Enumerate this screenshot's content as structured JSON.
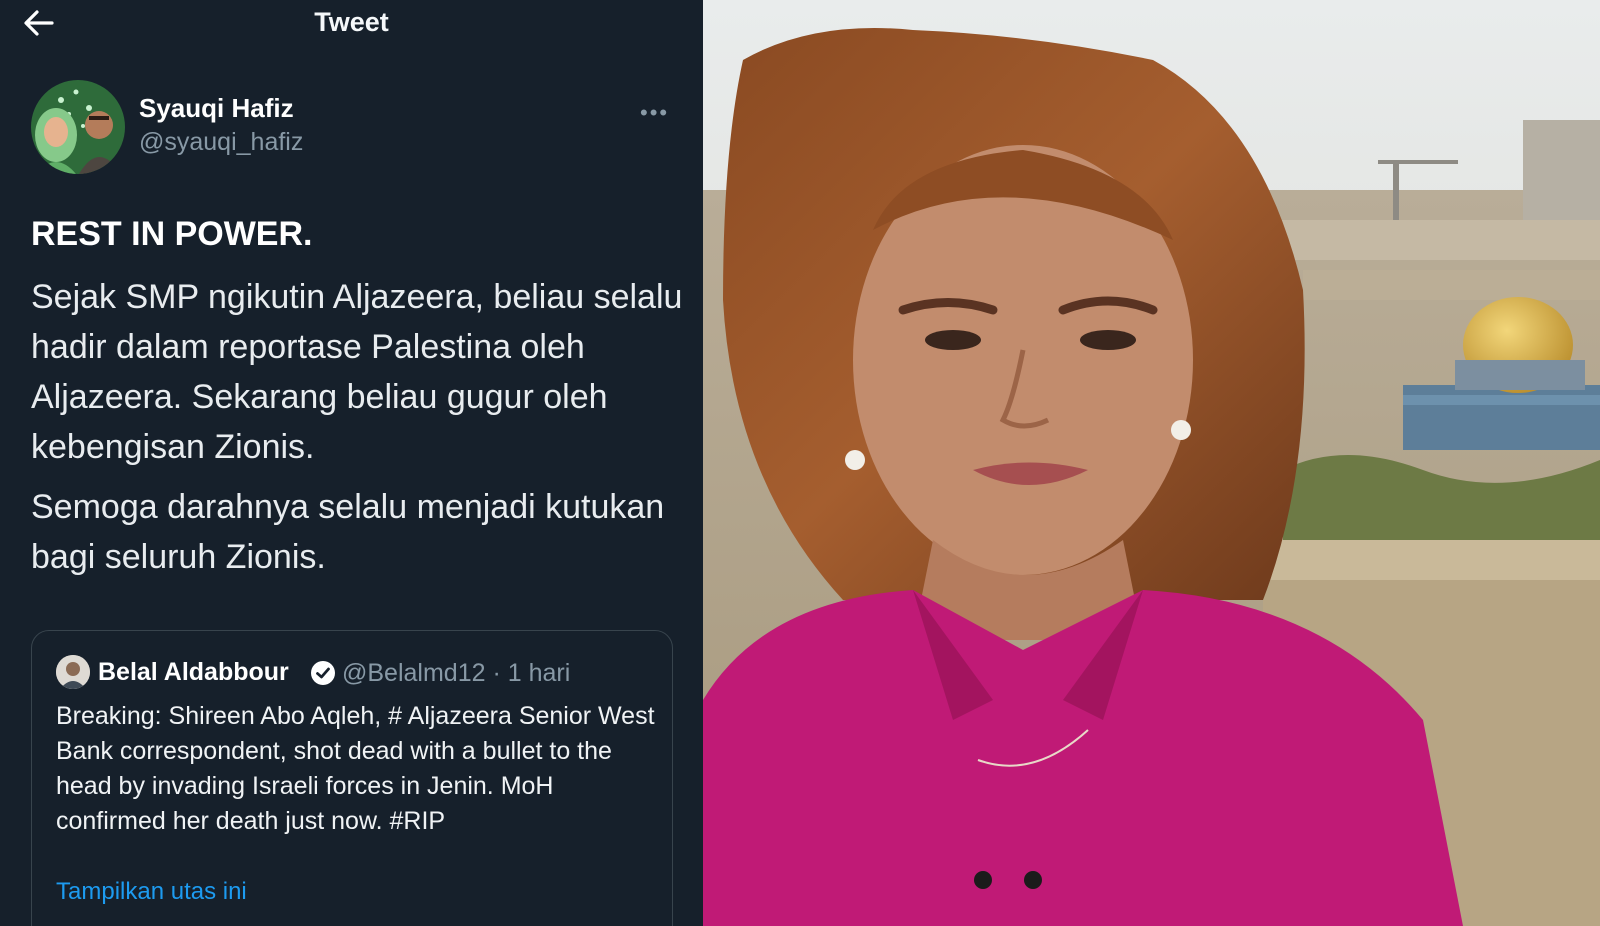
{
  "header": {
    "title": "Tweet",
    "back_icon": "arrow-left-icon"
  },
  "tweet": {
    "author_name": "Syauqi Hafiz",
    "author_handle": "@syauqi_hafiz",
    "more_icon": "ellipsis-icon",
    "headline": "REST IN POWER.",
    "paragraph1": "Sejak SMP ngikutin Aljazeera, beliau selalu hadir dalam reportase Palestina oleh Aljazeera. Sekarang beliau gugur oleh kebengisan Zionis.",
    "paragraph2": "Semoga darahnya selalu menjadi kutukan bagi seluruh Zionis."
  },
  "quoted_tweet": {
    "author_name": "Belal Aldabbour",
    "verified_icon": "verified-badge-icon",
    "meta": "@Belalmd12 · 1 hari",
    "text": "Breaking: Shireen Abo Aqleh, # Aljazeera Senior West Bank correspondent, shot dead with a bullet to the head by invading Israeli forces in Jenin. MoH confirmed her death just now. #RIP",
    "thread_link": "Tampilkan utas ini"
  },
  "colors": {
    "background": "#16202b",
    "text_secondary": "#8899a6",
    "link": "#1d9bf0",
    "border": "#38444d"
  }
}
